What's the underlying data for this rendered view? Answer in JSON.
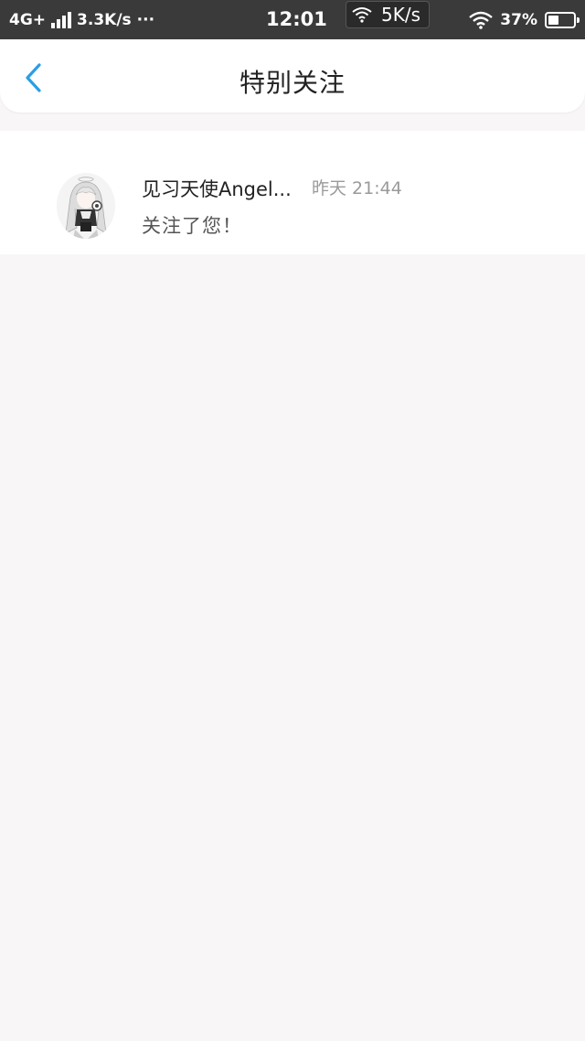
{
  "status_bar": {
    "network": "4G+",
    "speed_left": "3.3K/s",
    "more": "···",
    "time": "12:01",
    "speed_pill": "5K/s",
    "battery": "37%"
  },
  "header": {
    "title": "特别关注"
  },
  "notifications": [
    {
      "name": "见习天使Angel...",
      "time": "昨天 21:44",
      "message": "关注了您！"
    }
  ],
  "colors": {
    "accent": "#2a9ee6",
    "status_bar_bg": "#3a3a3a",
    "page_bg": "#f8f6f7"
  }
}
